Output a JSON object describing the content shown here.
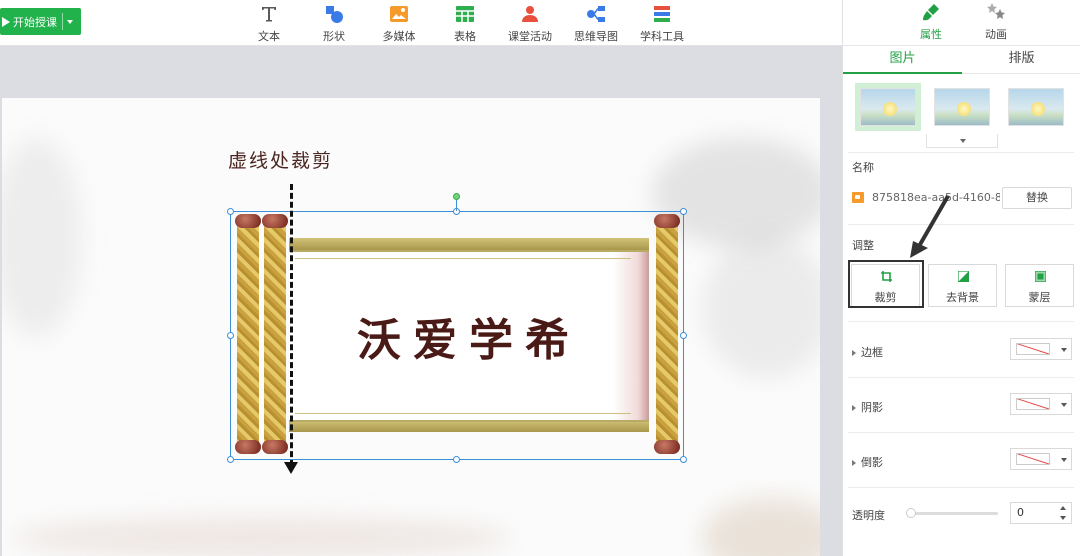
{
  "toolbar": {
    "start_label": "开始授课",
    "tools": [
      {
        "label": "文本",
        "icon": "text-icon"
      },
      {
        "label": "形状",
        "icon": "shape-icon"
      },
      {
        "label": "多媒体",
        "icon": "media-icon"
      },
      {
        "label": "表格",
        "icon": "table-icon"
      },
      {
        "label": "课堂活动",
        "icon": "class-activity-icon"
      },
      {
        "label": "思维导图",
        "icon": "mindmap-icon"
      },
      {
        "label": "学科工具",
        "icon": "subject-tools-icon"
      }
    ]
  },
  "slide": {
    "annotation": "虚线处裁剪",
    "scroll_title": "沃爱学希"
  },
  "panel": {
    "tabs": [
      {
        "label": "属性",
        "icon": "brush-icon",
        "active": true
      },
      {
        "label": "动画",
        "icon": "stars-icon",
        "active": false
      }
    ],
    "subtabs": [
      {
        "label": "图片",
        "active": true
      },
      {
        "label": "排版",
        "active": false
      }
    ],
    "name_label": "名称",
    "file_name": "875818ea-aa5d-4160-8...",
    "replace_label": "替换",
    "adjust_label": "调整",
    "adjust_buttons": [
      {
        "label": "裁剪",
        "icon": "crop-icon"
      },
      {
        "label": "去背景",
        "icon": "remove-background-icon"
      },
      {
        "label": "蒙层",
        "icon": "mask-layer-icon"
      }
    ],
    "rows": [
      {
        "label": "边框"
      },
      {
        "label": "阴影"
      },
      {
        "label": "倒影"
      }
    ],
    "opacity_label": "透明度",
    "opacity_value": "0",
    "accent_color": "#22a046"
  }
}
